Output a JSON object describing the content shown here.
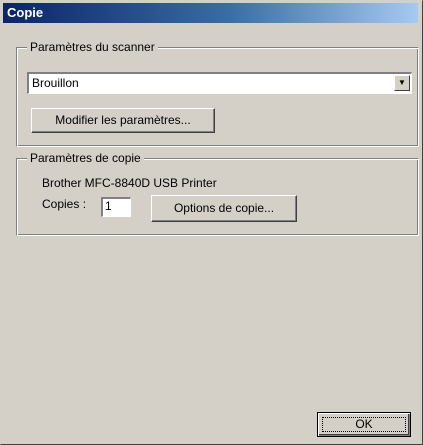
{
  "window": {
    "title": "Copie"
  },
  "scanner_group": {
    "legend": "Paramètres du scanner",
    "combo_value": "Brouillon",
    "modify_button": "Modifier les paramètres..."
  },
  "copy_group": {
    "legend": "Paramètres de copie",
    "printer_name": "Brother MFC-8840D USB Printer",
    "copies_label": "Copies :",
    "copies_value": "1",
    "options_button": "Options de copie..."
  },
  "footer": {
    "ok_button": "OK"
  },
  "icons": {
    "dropdown": "chevron-down-icon"
  },
  "colors": {
    "face": "#d4d0c8",
    "titlebar_start": "#0a246a",
    "titlebar_end": "#a6caf0"
  }
}
